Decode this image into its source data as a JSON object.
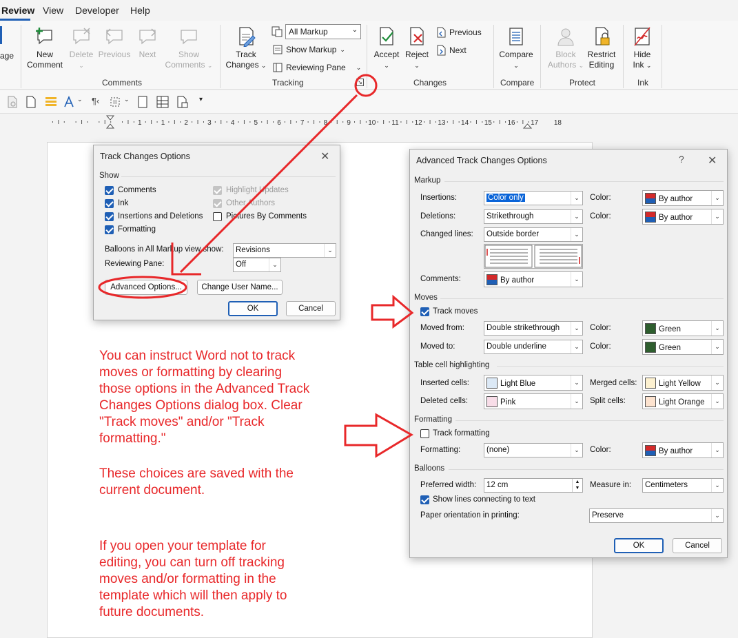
{
  "menu": {
    "tabs": [
      "Review",
      "View",
      "Developer",
      "Help"
    ]
  },
  "ribbon": {
    "left_partial": "age",
    "comments": {
      "new_comment": [
        "New",
        "Comment"
      ],
      "delete": [
        "Delete"
      ],
      "previous": [
        "Previous"
      ],
      "next": [
        "Next"
      ],
      "show_comments": [
        "Show",
        "Comments"
      ],
      "group_label": "Comments"
    },
    "tracking": {
      "track_changes": [
        "Track",
        "Changes"
      ],
      "markup_combo": "All Markup",
      "show_markup": "Show Markup",
      "reviewing_pane": "Reviewing Pane",
      "group_label": "Tracking"
    },
    "changes": {
      "accept": "Accept",
      "reject": "Reject",
      "previous": "Previous",
      "next": "Next",
      "group_label": "Changes"
    },
    "compare": {
      "label": "Compare",
      "group_label": "Compare"
    },
    "protect": {
      "block_authors": [
        "Block",
        "Authors"
      ],
      "restrict_editing": [
        "Restrict",
        "Editing"
      ],
      "group_label": "Protect"
    },
    "ink": {
      "hide_ink": [
        "Hide",
        "Ink"
      ],
      "group_label": "Ink"
    }
  },
  "ruler": {
    "numbers": [
      "1",
      "1",
      "2",
      "3",
      "4",
      "5",
      "6",
      "7",
      "8",
      "9",
      "10",
      "11",
      "12",
      "13",
      "14",
      "15",
      "16",
      "17",
      "18"
    ]
  },
  "tco_dialog": {
    "title": "Track Changes Options",
    "show_label": "Show",
    "checks": [
      {
        "label": "Comments",
        "checked": true
      },
      {
        "label": "Ink",
        "checked": true
      },
      {
        "label": "Insertions and Deletions",
        "checked": true
      },
      {
        "label": "Formatting",
        "checked": true
      },
      {
        "label": "Highlight Updates",
        "checked": true,
        "disabled": true
      },
      {
        "label": "Other Authors",
        "checked": true,
        "disabled": true
      },
      {
        "label": "Pictures By Comments",
        "checked": false
      }
    ],
    "balloons_label": "Balloons in All Markup view show:",
    "balloons_value": "Revisions",
    "pane_label": "Reviewing Pane:",
    "pane_value": "Off",
    "advanced_btn": "Advanced Options...",
    "change_user_btn": "Change User Name...",
    "ok": "OK",
    "cancel": "Cancel"
  },
  "atco_dialog": {
    "title": "Advanced Track Changes Options",
    "help": "?",
    "markup_section": "Markup",
    "insertions_label": "Insertions:",
    "insertions_value": "Color only",
    "deletions_label": "Deletions:",
    "deletions_value": "Strikethrough",
    "changed_lines_label": "Changed lines:",
    "changed_lines_value": "Outside border",
    "color_label": "Color:",
    "by_author": "By author",
    "comments_label": "Comments:",
    "moves_section": "Moves",
    "track_moves": "Track moves",
    "track_moves_checked": true,
    "moved_from_label": "Moved from:",
    "moved_from_value": "Double strikethrough",
    "moved_to_label": "Moved to:",
    "moved_to_value": "Double underline",
    "green": "Green",
    "table_section": "Table cell highlighting",
    "inserted_cells_label": "Inserted cells:",
    "inserted_cells_value": "Light Blue",
    "deleted_cells_label": "Deleted cells:",
    "deleted_cells_value": "Pink",
    "merged_cells_label": "Merged cells:",
    "merged_cells_value": "Light Yellow",
    "split_cells_label": "Split cells:",
    "split_cells_value": "Light Orange",
    "formatting_section": "Formatting",
    "track_formatting": "Track formatting",
    "track_formatting_checked": false,
    "formatting_label": "Formatting:",
    "formatting_value": "(none)",
    "balloons_section": "Balloons",
    "preferred_width_label": "Preferred width:",
    "preferred_width_value": "12 cm",
    "measure_in_label": "Measure in:",
    "measure_in_value": "Centimeters",
    "show_lines": "Show lines connecting to text",
    "show_lines_checked": true,
    "paper_orientation_label": "Paper orientation in printing:",
    "paper_orientation_value": "Preserve",
    "ok": "OK",
    "cancel": "Cancel"
  },
  "colors": {
    "accent": "#1f5fb5",
    "annotation_red": "#e8282a",
    "green_swatch": "#2e5e2e",
    "light_blue": "#dce9f6",
    "pink": "#f8dde8",
    "light_yellow": "#fdf1d0",
    "light_orange": "#fde3cf"
  },
  "annotations": {
    "para1": [
      "You can instruct Word not to track",
      "moves or formatting by clearing",
      "those options in the Advanced Track",
      "Changes Options dialog box. Clear",
      "\"Track moves\" and/or \"Track",
      "formatting.\""
    ],
    "para2": [
      "These choices are saved with the",
      "current document."
    ],
    "para3": [
      "If you open your template for",
      "editing, you can turn off tracking",
      "moves and/or formatting in the",
      "template which will then apply to",
      "future documents."
    ]
  }
}
